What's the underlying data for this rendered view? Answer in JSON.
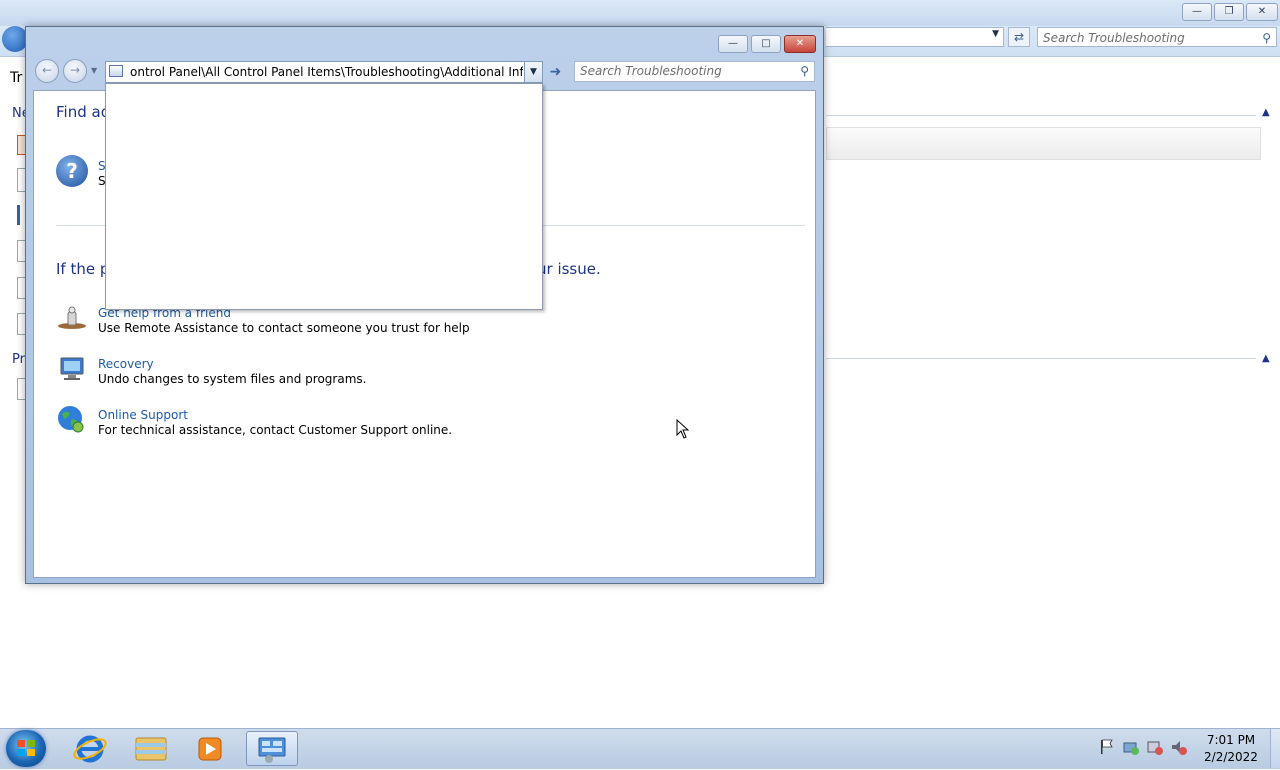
{
  "background_window": {
    "search_placeholder": "Search Troubleshooting",
    "sidebar_fragments": [
      "Tr",
      "Ne",
      "Pri"
    ]
  },
  "foreground_window": {
    "address_path": "ontrol Panel\\All Control Panel Items\\Troubleshooting\\Additional Informati",
    "search_placeholder": "Search Troubleshooting",
    "section1_heading": "Find ad",
    "section1_item_title": "S",
    "section1_item_desc": "S",
    "section2_heading_start": "If the p",
    "section2_heading_end": "ur issue.",
    "items": [
      {
        "title": "Get help from a friend",
        "desc": "Use Remote Assistance to contact someone you trust for help",
        "icon": "remote-assistance-icon"
      },
      {
        "title": "Recovery",
        "desc": "Undo changes to system files and programs.",
        "icon": "recovery-icon"
      },
      {
        "title": "Online Support",
        "desc": "For technical assistance, contact Customer Support online.",
        "icon": "globe-icon"
      }
    ]
  },
  "taskbar": {
    "time": "7:01 PM",
    "date": "2/2/2022"
  },
  "colors": {
    "heading": "#1e3287",
    "link": "#1e5aa8",
    "chrome": "#bcd0ea"
  }
}
